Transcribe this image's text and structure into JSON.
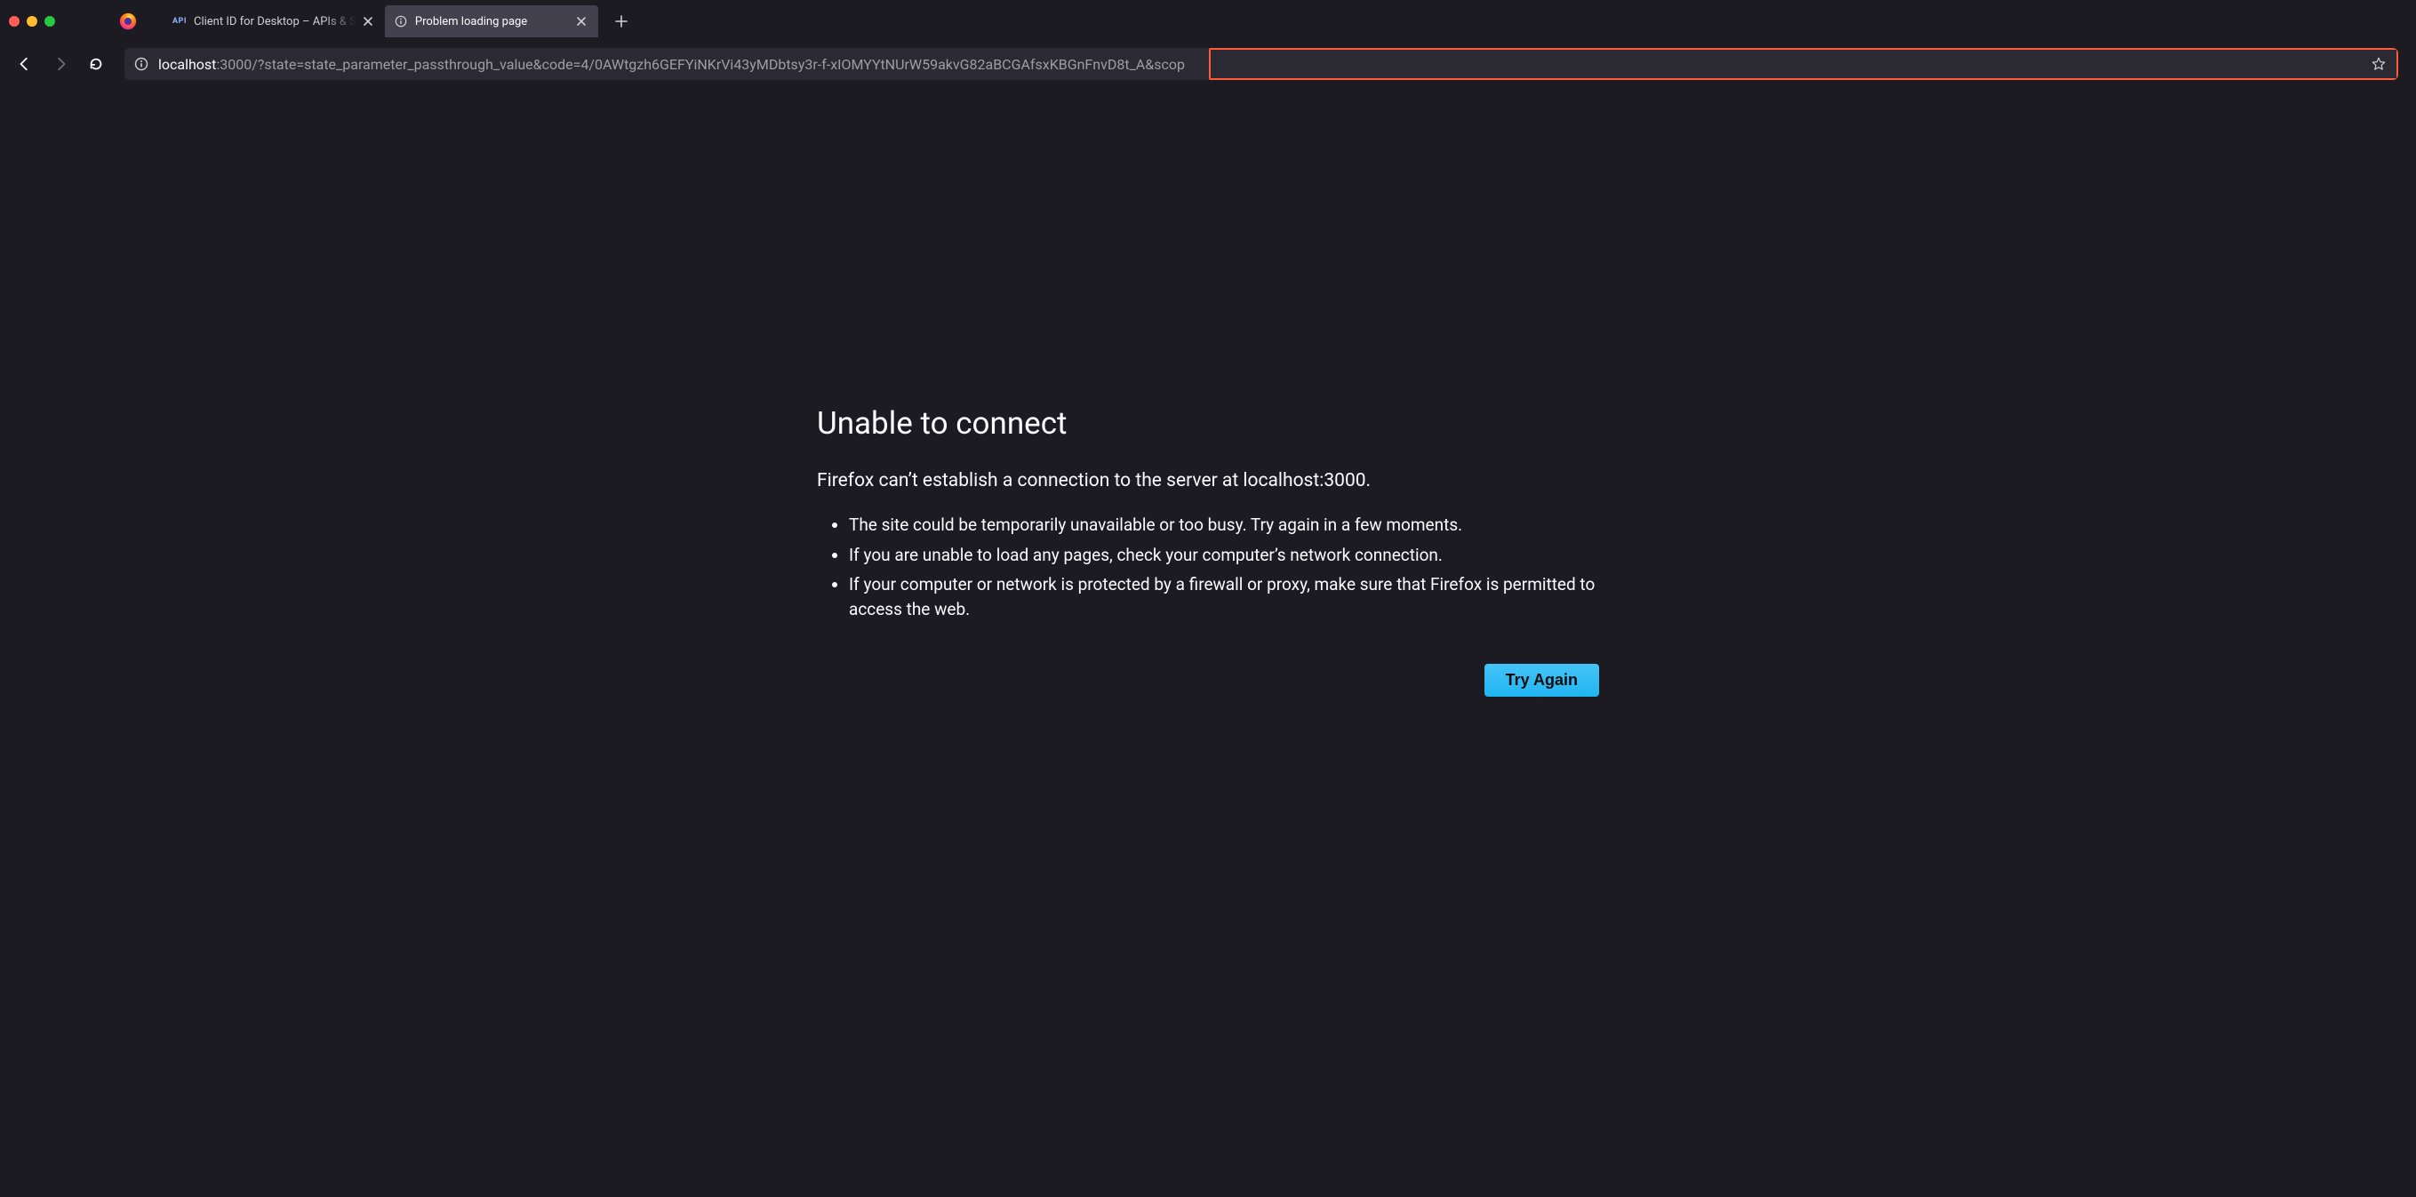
{
  "window": {
    "traffic_lights": {
      "close": "close",
      "minimize": "minimize",
      "maximize": "maximize"
    }
  },
  "tabs": [
    {
      "favicon": "API",
      "title": "Client ID for Desktop – APIs & S",
      "active": false
    },
    {
      "favicon": "info",
      "title": "Problem loading page",
      "active": true
    }
  ],
  "toolbar": {
    "back_enabled": true,
    "forward_enabled": false,
    "url": {
      "host": "localhost",
      "rest": ":3000/?state=state_parameter_passthrough_value&",
      "highlighted": "code=4/0AWtgzh6GEFYiNKrVi43yMDbtsy3r-f-xIOMYYtNUrW59akvG82aBCGAfsxKBGnFnvD8t_A&scop"
    }
  },
  "error": {
    "heading": "Unable to connect",
    "subhead": "Firefox can’t establish a connection to the server at localhost:3000.",
    "bullets": [
      "The site could be temporarily unavailable or too busy. Try again in a few moments.",
      "If you are unable to load any pages, check your computer’s network connection.",
      "If your computer or network is protected by a firewall or proxy, make sure that Firefox is permitted to access the web."
    ],
    "try_again_label": "Try Again"
  },
  "annotation": {
    "highlight_color": "#ff5b3a"
  }
}
